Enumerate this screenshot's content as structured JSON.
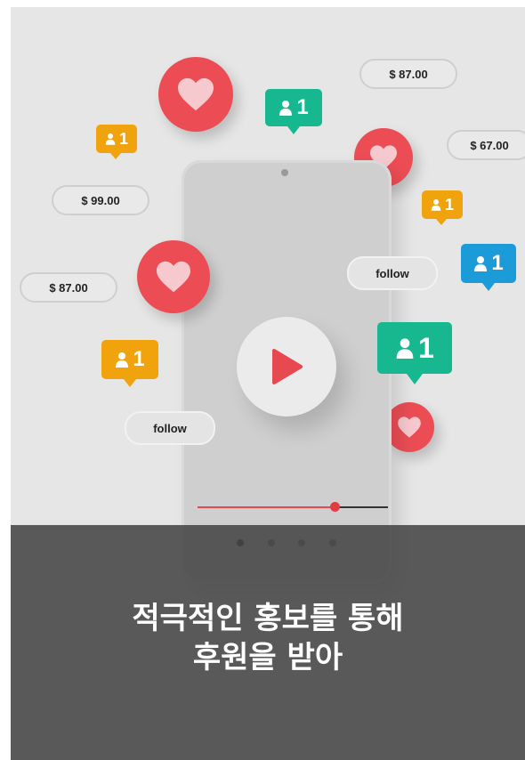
{
  "prices": {
    "top_right": "$ 87.00",
    "right": "$ 67.00",
    "left_upper": "$ 99.00",
    "left_middle": "$ 87.00"
  },
  "follow": {
    "right": "follow",
    "left": "follow"
  },
  "badges": {
    "count": "1"
  },
  "video": {
    "progress": 0.72
  },
  "carousel": {
    "active_index": 0,
    "dot_count": 4
  },
  "caption": {
    "line1": "적극적인 홍보를 통해",
    "line2": "후원을 받아"
  },
  "colors": {
    "heart_red": "#ec4d55",
    "play_red": "#e8484f",
    "badge_teal": "#17b890",
    "badge_orange": "#f0a30c",
    "badge_blue": "#1b9bd8"
  }
}
